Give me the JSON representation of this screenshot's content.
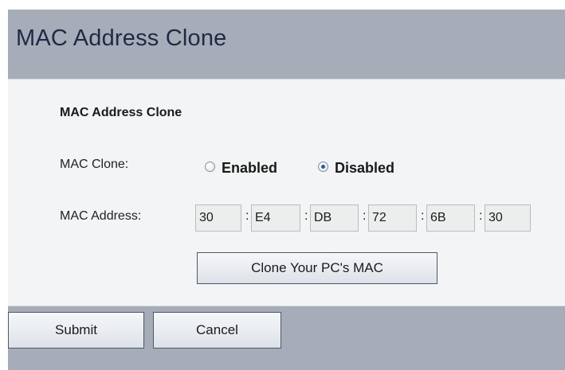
{
  "page": {
    "title": "MAC Address Clone"
  },
  "panel": {
    "section_title": "MAC Address Clone",
    "mac_clone": {
      "label": "MAC Clone:",
      "options": [
        "Enabled",
        "Disabled"
      ],
      "selected": "Disabled"
    },
    "mac_address": {
      "label": "MAC Address:",
      "separator": ":",
      "octets": [
        "30",
        "E4",
        "DB",
        "72",
        "6B",
        "30"
      ]
    },
    "clone_button_label": "Clone Your PC's MAC"
  },
  "footer": {
    "submit_label": "Submit",
    "cancel_label": "Cancel"
  },
  "colors": {
    "window_bg": "#a6adb9",
    "panel_bg": "#f2f4f5",
    "title_text": "#1f2a44",
    "radio_dot": "#1e5fa8"
  }
}
